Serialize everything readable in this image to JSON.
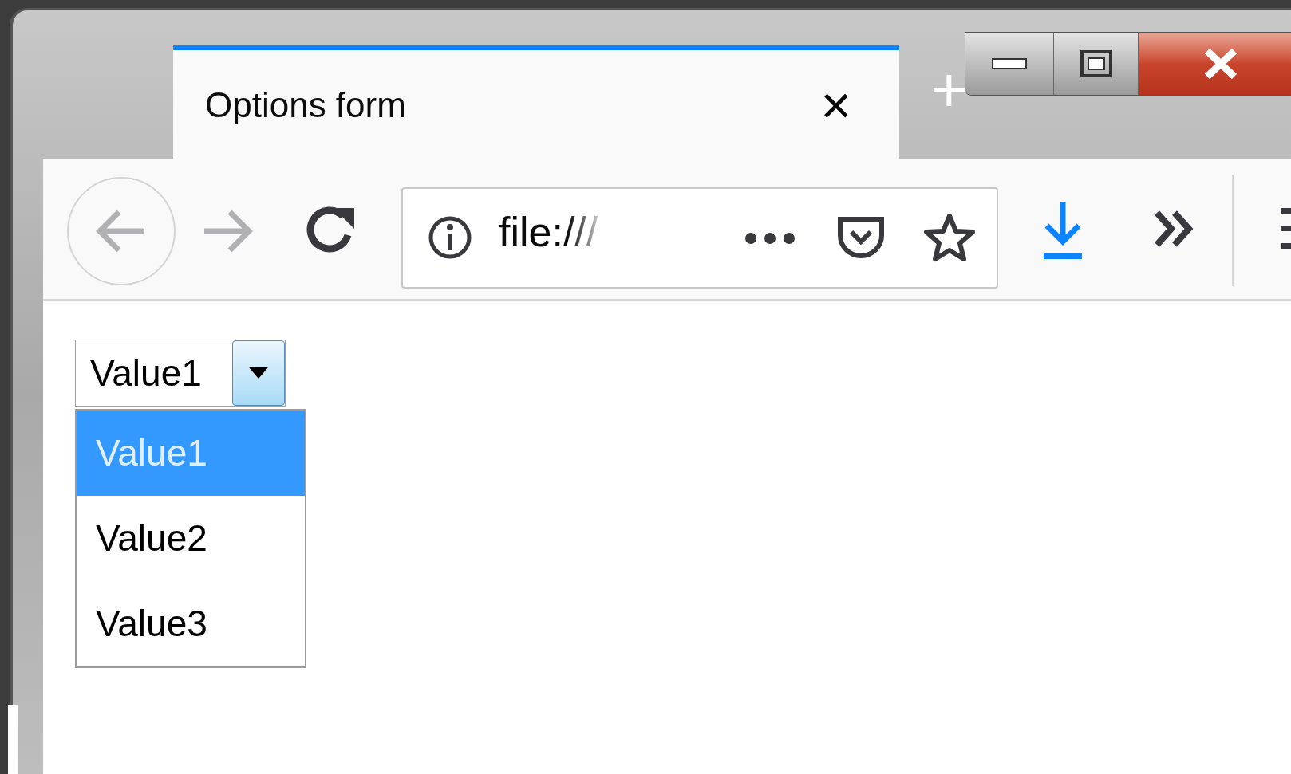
{
  "tab": {
    "title": "Options form",
    "close": "×",
    "selected": true
  },
  "new_tab": "+",
  "address_bar": {
    "url": "file:///"
  },
  "select": {
    "value": "Value1",
    "expanded": true,
    "options": [
      {
        "label": "Value1",
        "selected": true
      },
      {
        "label": "Value2",
        "selected": false
      },
      {
        "label": "Value3",
        "selected": false
      }
    ]
  }
}
